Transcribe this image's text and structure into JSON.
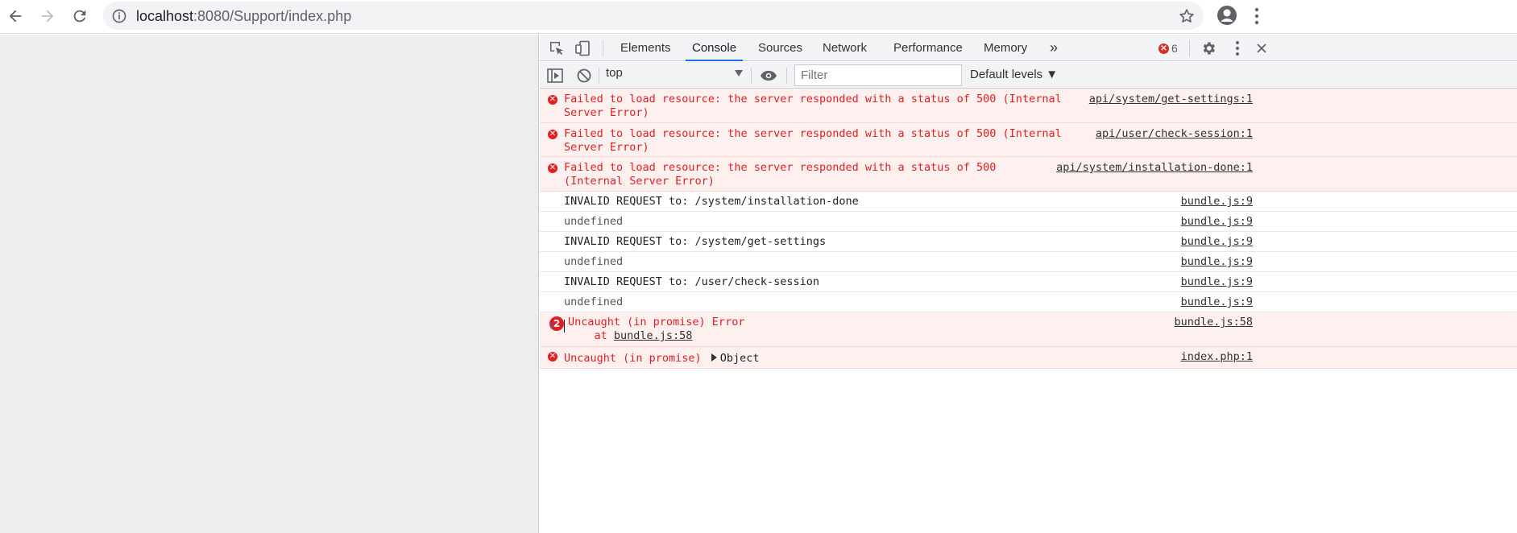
{
  "browser": {
    "url_host": "localhost",
    "url_rest": ":8080/Support/index.php"
  },
  "devtools": {
    "tabs": [
      "Elements",
      "Console",
      "Sources",
      "Network",
      "Performance",
      "Memory"
    ],
    "active_tab": "Console",
    "more_tabs": "»",
    "error_count": "6",
    "context": "top",
    "filter_placeholder": "Filter",
    "levels": "Default levels ▼"
  },
  "console": {
    "messages": [
      {
        "type": "error",
        "text_line1": "Failed to load resource: the server responded with a status of 500 (Internal",
        "text_line2": "Server Error)",
        "source": "api/system/get-settings:1"
      },
      {
        "type": "error",
        "text_line1": "Failed to load resource: the server responded with a status of 500 (Internal",
        "text_line2": "Server Error)",
        "source": "api/user/check-session:1"
      },
      {
        "type": "error",
        "text_line1": "Failed to load resource: the server responded with a status of 500",
        "text_line2": "(Internal Server Error)",
        "source": "api/system/installation-done:1"
      },
      {
        "type": "log",
        "text": "INVALID REQUEST to: /system/installation-done",
        "source": "bundle.js:9"
      },
      {
        "type": "log-gray",
        "text": "undefined",
        "source": "bundle.js:9"
      },
      {
        "type": "log",
        "text": "INVALID REQUEST to: /system/get-settings",
        "source": "bundle.js:9"
      },
      {
        "type": "log-gray",
        "text": "undefined",
        "source": "bundle.js:9"
      },
      {
        "type": "log",
        "text": "INVALID REQUEST to: /user/check-session",
        "source": "bundle.js:9"
      },
      {
        "type": "log-gray",
        "text": "undefined",
        "source": "bundle.js:9"
      },
      {
        "type": "error-grouped",
        "count": "2",
        "text_line1": "Uncaught (in promise) Error",
        "stack_prefix": "    at ",
        "stack_link": "bundle.js:58",
        "source": "bundle.js:58"
      },
      {
        "type": "error-object",
        "text": "Uncaught (in promise)",
        "object_label": "Object",
        "source": "index.php:1"
      }
    ],
    "prompt_symbol": "›"
  }
}
